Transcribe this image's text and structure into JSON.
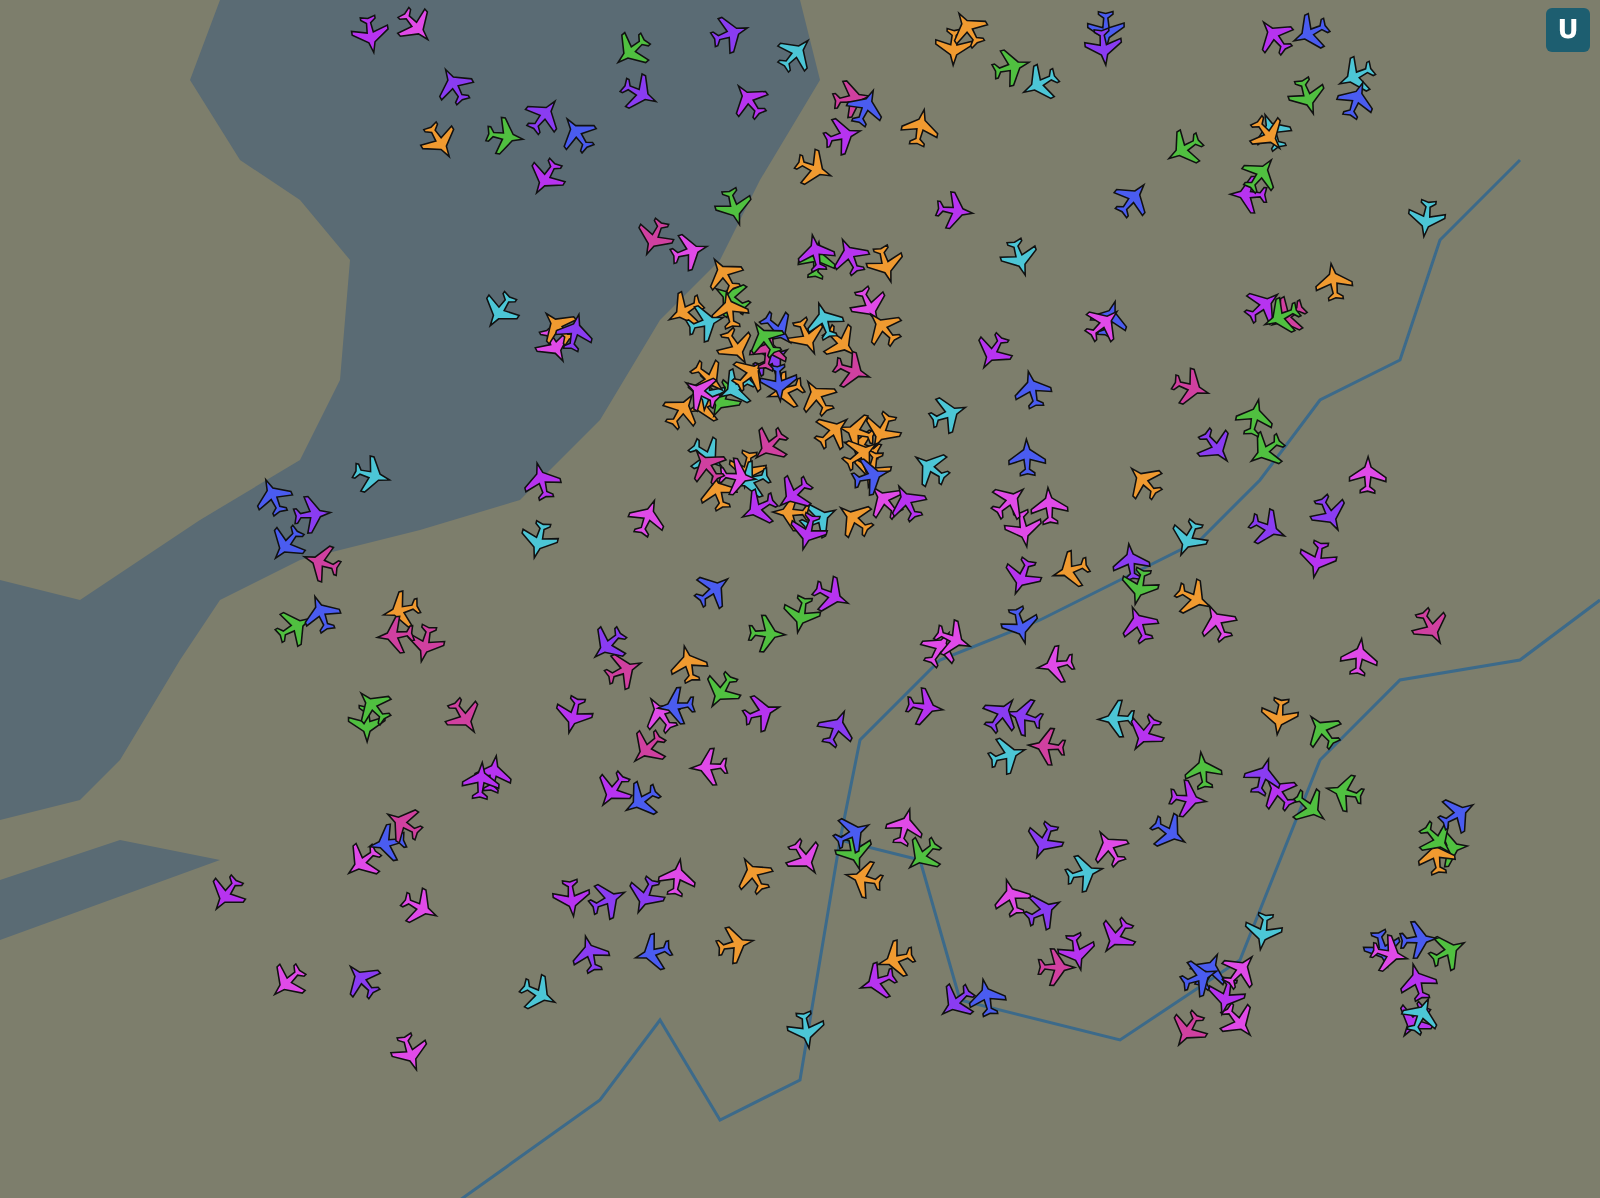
{
  "toolbar_button": {
    "label": "U"
  }
}
